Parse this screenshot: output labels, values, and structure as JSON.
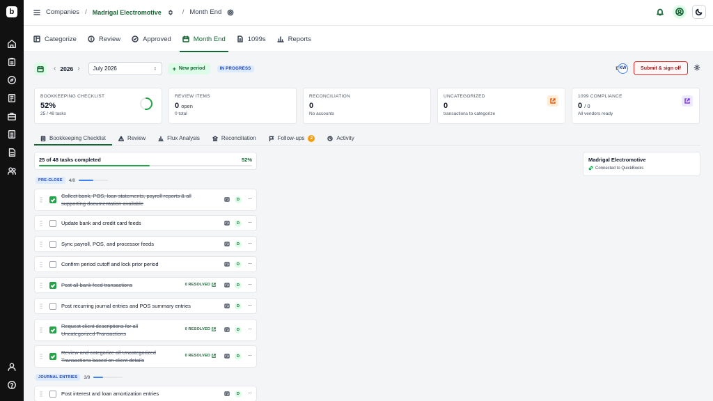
{
  "breadcrumb": {
    "root": "Companies",
    "company": "Madrigal Electromotive",
    "page": "Month End"
  },
  "nav": {
    "tabs": [
      {
        "label": "Categorize",
        "icon": "categorize-icon"
      },
      {
        "label": "Review",
        "icon": "info-icon"
      },
      {
        "label": "Approved",
        "icon": "check-circle-icon"
      },
      {
        "label": "Month End",
        "icon": "calendar-icon",
        "active": true
      },
      {
        "label": "1099s",
        "icon": "document-icon"
      },
      {
        "label": "Reports",
        "icon": "bar-chart-icon"
      }
    ]
  },
  "period": {
    "year": "2026",
    "month": "July 2026",
    "new_period": "New period",
    "status": "IN PROGRESS",
    "avatar_prefix": "D",
    "avatar_initials": "KW",
    "submit": "Submit & sign off"
  },
  "cards": {
    "checklist": {
      "label": "BOOKKEEPING CHECKLIST",
      "value": "52%",
      "sub": "25 / 48 tasks",
      "progress": 0.52
    },
    "review": {
      "label": "REVIEW ITEMS",
      "value": "0",
      "unit": "open",
      "sub": "0 total"
    },
    "reconciliation": {
      "label": "RECONCILIATION",
      "value": "0",
      "sub": "No accounts"
    },
    "uncategorized": {
      "label": "UNCATEGORIZED",
      "value": "0",
      "sub": "transactions to categorize"
    },
    "compliance": {
      "label": "1099 COMPLIANCE",
      "value": "0",
      "unit": "/ 0",
      "sub": "All vendors ready"
    }
  },
  "subtabs": [
    {
      "label": "Bookkeeping Checklist",
      "active": true
    },
    {
      "label": "Review"
    },
    {
      "label": "Flux Analysis"
    },
    {
      "label": "Reconciliation"
    },
    {
      "label": "Follow-ups",
      "badge": "2"
    },
    {
      "label": "Activity"
    }
  ],
  "progress": {
    "text": "25 of 48 tasks completed",
    "pct": "52%",
    "fraction": 0.52
  },
  "sections": {
    "preclose": {
      "tag": "PRE-CLOSE",
      "count": "4/8",
      "fraction": 0.5
    },
    "journal": {
      "tag": "JOURNAL ENTRIES",
      "count": "3/9",
      "fraction": 0.33
    }
  },
  "tasks": [
    {
      "line1": "Collect bank, POS, loan statements, payroll reports & all",
      "line2": "supporting documentation available",
      "done": true,
      "badge": "D"
    },
    {
      "line1": "Update bank and credit card feeds",
      "done": false,
      "badge": "D"
    },
    {
      "line1": "Sync payroll, POS, and processor feeds",
      "done": false,
      "badge": "D"
    },
    {
      "line1": "Confirm period cutoff and lock prior period",
      "done": false,
      "badge": "D"
    },
    {
      "line1": "Post all bank feed transactions",
      "done": true,
      "resolved": "0 RESOLVED",
      "badge": "D"
    },
    {
      "line1": "Post recurring journal entries and POS summary entries",
      "done": false,
      "badge": "D"
    },
    {
      "line1": "Request client descriptions for all",
      "line2": "Uncategorized Transactions",
      "done": true,
      "resolved": "0 RESOLVED",
      "badge": "D"
    },
    {
      "line1": "Review and categorize all Uncategorized",
      "line2": "Transactions based on client details",
      "done": true,
      "resolved": "0 RESOLVED",
      "badge": "D"
    },
    {
      "line1": "Post interest and loan amortization entries",
      "done": false,
      "badge": "D"
    }
  ],
  "client": {
    "name": "Madrigal Electromotive",
    "status": "Connected to QuickBooks"
  },
  "colors": {
    "brand": "#166534",
    "accent": "#22a447",
    "danger": "#dc2626",
    "sidebar": "#111111"
  }
}
